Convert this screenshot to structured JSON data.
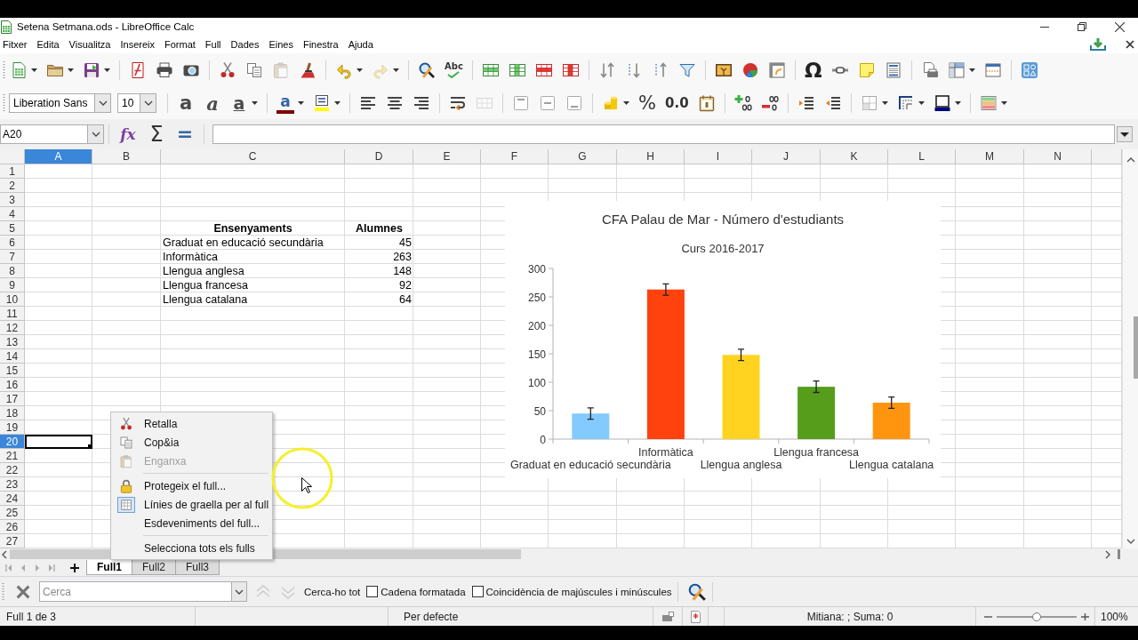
{
  "window": {
    "title": "Setena Setmana.ods - LibreOffice Calc"
  },
  "menu_bar": [
    "Fitxer",
    "Edita",
    "Visualitza",
    "Insereix",
    "Format",
    "Full",
    "Dades",
    "Eines",
    "Finestra",
    "Ajuda"
  ],
  "standard_toolbar": [
    {
      "disabled": false
    },
    {
      "disabled": false
    },
    {
      "disabled": false
    },
    {
      "disabled": false
    },
    {
      "disabled": false
    },
    {
      "disabled": false
    },
    {
      "disabled": false
    },
    {
      "disabled": false
    },
    {
      "disabled": true
    },
    {
      "disabled": false
    },
    {
      "disabled": false
    },
    {
      "disabled": true
    },
    {
      "disabled": false
    },
    {
      "label": "Abc",
      "disabled": false
    },
    {
      "disabled": false
    },
    {
      "disabled": false
    },
    {
      "disabled": false
    },
    {
      "disabled": false
    },
    {
      "disabled": false
    },
    {
      "disabled": false
    },
    {
      "disabled": false
    },
    {
      "disabled": false
    },
    {
      "disabled": false
    },
    {
      "disabled": false
    },
    {
      "disabled": false
    },
    {
      "label": "Ω",
      "disabled": false
    },
    {
      "disabled": false
    },
    {
      "disabled": false
    },
    {
      "disabled": false
    },
    {
      "disabled": false
    },
    {
      "disabled": false
    },
    {
      "disabled": false
    },
    {
      "disabled": false
    }
  ],
  "formatting_toolbar": {
    "font_name": "Liberation Sans",
    "font_size": "10",
    "buttons": [
      {
        "label": "a",
        "disabled": false
      },
      {
        "label": "a",
        "disabled": false
      },
      {
        "label": "a",
        "disabled": false
      },
      {
        "label": "a",
        "disabled": false
      },
      {
        "disabled": false
      },
      {
        "disabled": false
      },
      {
        "disabled": false
      },
      {
        "disabled": false
      },
      {
        "disabled": false
      },
      {
        "disabled": true
      },
      {
        "disabled": false
      },
      {
        "disabled": false
      },
      {
        "disabled": false
      },
      {
        "disabled": false
      },
      {
        "label": "%",
        "disabled": false
      },
      {
        "label": "0.0",
        "disabled": false
      },
      {
        "disabled": false
      },
      {
        "disabled": false
      },
      {
        "disabled": false
      },
      {
        "disabled": false
      },
      {
        "disabled": false
      },
      {
        "disabled": false
      },
      {
        "disabled": false
      },
      {
        "disabled": false
      },
      {
        "disabled": false
      }
    ]
  },
  "formula_bar": {
    "name_box": "A20",
    "buttons": [
      "fx",
      "Σ",
      "="
    ]
  },
  "sheet": {
    "columns": [
      {
        "label": "A",
        "selected": true
      },
      {
        "label": "B",
        "selected": false
      },
      {
        "label": "C",
        "selected": false
      },
      {
        "label": "D",
        "selected": false
      },
      {
        "label": "E",
        "selected": false
      },
      {
        "label": "F",
        "selected": false
      },
      {
        "label": "G",
        "selected": false
      },
      {
        "label": "H",
        "selected": false
      },
      {
        "label": "I",
        "selected": false
      },
      {
        "label": "J",
        "selected": false
      },
      {
        "label": "K",
        "selected": false
      },
      {
        "label": "L",
        "selected": false
      },
      {
        "label": "M",
        "selected": false
      },
      {
        "label": "N",
        "selected": false
      }
    ],
    "rows": [
      {
        "label": "1",
        "selected": false
      },
      {
        "label": "2",
        "selected": false
      },
      {
        "label": "3",
        "selected": false
      },
      {
        "label": "4",
        "selected": false
      },
      {
        "label": "5",
        "selected": false
      },
      {
        "label": "6",
        "selected": false
      },
      {
        "label": "7",
        "selected": false
      },
      {
        "label": "8",
        "selected": false
      },
      {
        "label": "9",
        "selected": false
      },
      {
        "label": "10",
        "selected": false
      },
      {
        "label": "11",
        "selected": false
      },
      {
        "label": "12",
        "selected": false
      },
      {
        "label": "13",
        "selected": false
      },
      {
        "label": "14",
        "selected": false
      },
      {
        "label": "15",
        "selected": false
      },
      {
        "label": "16",
        "selected": false
      },
      {
        "label": "17",
        "selected": false
      },
      {
        "label": "18",
        "selected": false
      },
      {
        "label": "19",
        "selected": false
      },
      {
        "label": "20",
        "selected": true
      },
      {
        "label": "21",
        "selected": false
      },
      {
        "label": "22",
        "selected": false
      },
      {
        "label": "23",
        "selected": false
      },
      {
        "label": "24",
        "selected": false
      },
      {
        "label": "25",
        "selected": false
      },
      {
        "label": "26",
        "selected": false
      },
      {
        "label": "27",
        "selected": false
      }
    ],
    "table": {
      "header": [
        "Ensenyaments",
        "Alumnes"
      ],
      "rows": [
        [
          "Graduat en educació secundària",
          "45"
        ],
        [
          "Informàtica",
          "263"
        ],
        [
          "Llengua anglesa",
          "148"
        ],
        [
          "Llengua francesa",
          "92"
        ],
        [
          "Llengua catalana",
          "64"
        ]
      ]
    },
    "chart": {
      "chart_data": [
        {
          "type": "bar",
          "title": "CFA Palau de Mar - Número d'estudiants",
          "subtitle": "Curs 2016-2017",
          "categories": [
            "Graduat en educació secundària",
            "Informàtica",
            "Llengua anglesa",
            "Llengua francesa",
            "Llengua catalana"
          ],
          "values": [
            45,
            263,
            148,
            92,
            64
          ],
          "colors": [
            "#83caff",
            "#ff420e",
            "#ffd320",
            "#579d1c",
            "#ff950e"
          ],
          "errors": [
            10,
            10,
            10,
            10,
            10
          ],
          "ylim": [
            0,
            300
          ],
          "yticks": [
            0,
            50,
            100,
            150,
            200,
            250,
            300
          ]
        }
      ]
    }
  },
  "context_menu": {
    "groups": [
      [
        {
          "label": "Retalla",
          "disabled": false,
          "checked": false
        },
        {
          "label": "Cop&ia",
          "disabled": false,
          "checked": false
        },
        {
          "label": "Enganxa",
          "disabled": true,
          "checked": false
        }
      ],
      [
        {
          "label": "Protegeix el full...",
          "disabled": false,
          "checked": false
        },
        {
          "label": "Línies de graella per al full",
          "disabled": false,
          "checked": true
        },
        {
          "label": "Esdeveniments del full...",
          "disabled": false,
          "checked": false
        }
      ],
      [
        {
          "label": "Selecciona tots els fulls",
          "disabled": false,
          "checked": false
        }
      ]
    ]
  },
  "sheet_tabs": [
    {
      "label": "Full1",
      "selected": true
    },
    {
      "label": "Full2",
      "selected": false
    },
    {
      "label": "Full3",
      "selected": false
    }
  ],
  "find_toolbar": {
    "placeholder": "Cerca",
    "navigation": [
      {
        "disabled": true
      },
      {
        "disabled": true
      }
    ],
    "find_all": "Cerca-ho tot",
    "options": [
      {
        "label": "Cadena formatada",
        "checked": false
      },
      {
        "label": "Coincidència de majúscules i minúscules",
        "checked": false
      }
    ]
  },
  "status_bar": {
    "sheet": "Full 1 de 3",
    "page_style": "Per defecte",
    "summary": "Mitiana: ; Suma: 0",
    "zoom": {
      "level": 0.5,
      "reading": "100%"
    }
  }
}
